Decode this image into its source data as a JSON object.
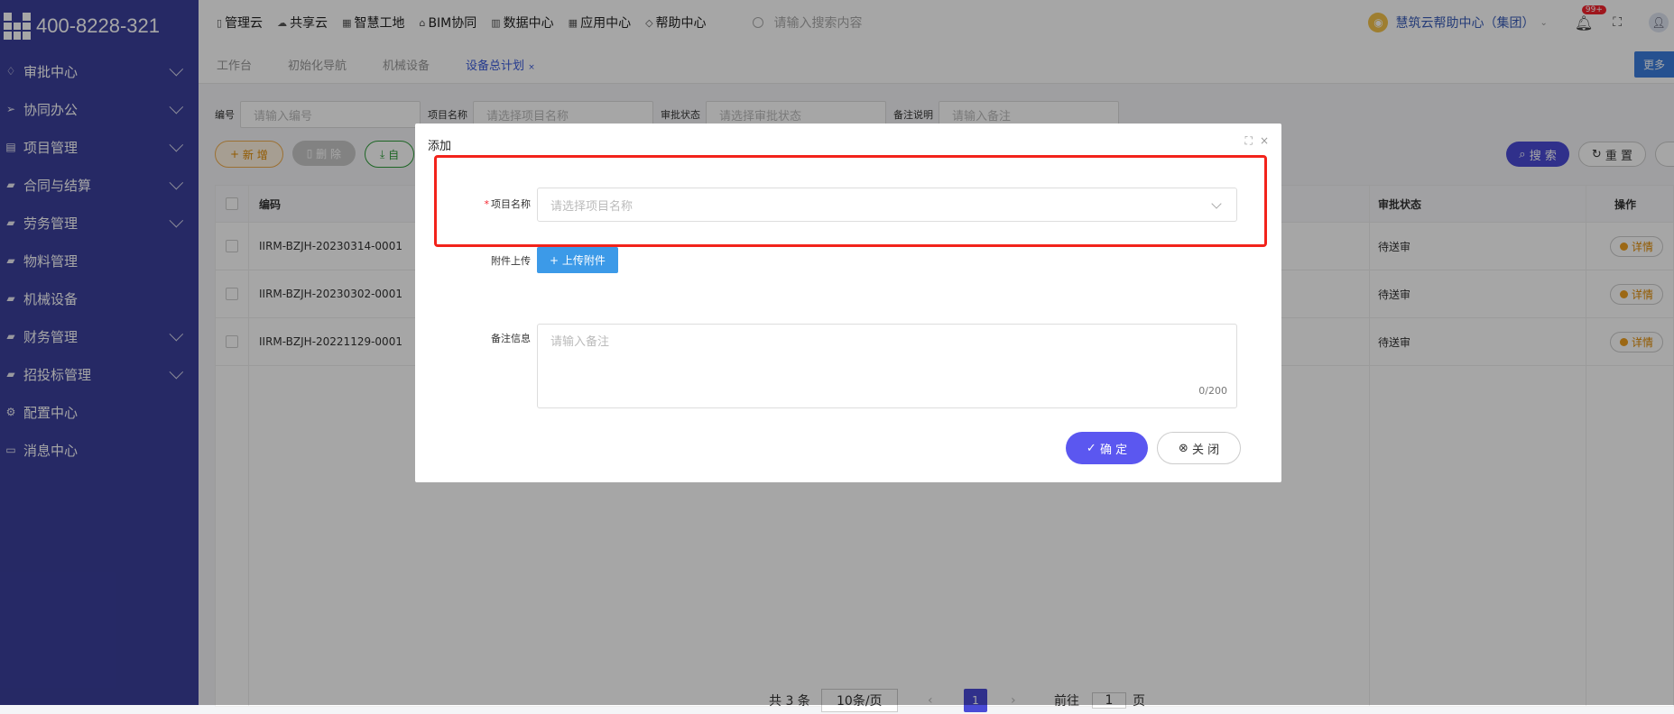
{
  "brand": {
    "phone": "400-8228-321"
  },
  "sidebar": {
    "items": [
      {
        "label": "审批中心",
        "icon": "bell-icon",
        "glyph": "♢",
        "expandable": true
      },
      {
        "label": "协同办公",
        "icon": "send-icon",
        "glyph": "➢",
        "expandable": true
      },
      {
        "label": "项目管理",
        "icon": "book-icon",
        "glyph": "▤",
        "expandable": true
      },
      {
        "label": "合同与结算",
        "icon": "contract-icon",
        "glyph": "▰",
        "expandable": true
      },
      {
        "label": "劳务管理",
        "icon": "worker-icon",
        "glyph": "▰",
        "expandable": true
      },
      {
        "label": "物料管理",
        "icon": "material-icon",
        "glyph": "▰",
        "expandable": false
      },
      {
        "label": "机械设备",
        "icon": "machine-icon",
        "glyph": "▰",
        "expandable": false
      },
      {
        "label": "财务管理",
        "icon": "finance-icon",
        "glyph": "▰",
        "expandable": true
      },
      {
        "label": "招投标管理",
        "icon": "bid-icon",
        "glyph": "▰",
        "expandable": true
      },
      {
        "label": "配置中心",
        "icon": "gear-icon",
        "glyph": "⚙",
        "expandable": false
      },
      {
        "label": "消息中心",
        "icon": "message-icon",
        "glyph": "▭",
        "expandable": false
      }
    ]
  },
  "topbar": {
    "nav": [
      "管理云",
      "共享云",
      "智慧工地",
      "BIM协同",
      "数据中心",
      "应用中心",
      "帮助中心"
    ],
    "search_placeholder": "请输入搜索内容",
    "company": "慧筑云帮助中心（集团）",
    "badge": "99+"
  },
  "tabs": [
    "工作台",
    "初始化导航",
    "机械设备",
    "设备总计划"
  ],
  "tab_more": "更多",
  "filters": {
    "code_label": "编号",
    "code_placeholder": "请输入编号",
    "project_label": "项目名称",
    "project_placeholder": "请选择项目名称",
    "status_label": "审批状态",
    "status_placeholder": "请选择审批状态",
    "remark_label": "备注说明",
    "remark_placeholder": "请输入备注"
  },
  "actions": {
    "add": "新 增",
    "delete": "删 除",
    "export": "自",
    "search": "搜 索",
    "reset": "重 置"
  },
  "table": {
    "headers": {
      "code": "编码",
      "status": "审批状态",
      "op": "操作"
    },
    "rows": [
      {
        "code": "IIRM-BZJH-20230314-0001",
        "status": "待送审",
        "detail": "详情"
      },
      {
        "code": "IIRM-BZJH-20230302-0001",
        "status": "待送审",
        "detail": "详情"
      },
      {
        "code": "IIRM-BZJH-20221129-0001",
        "status": "待送审",
        "detail": "详情"
      }
    ]
  },
  "pager": {
    "total": "共 3 条",
    "size": "10条/页",
    "current": "1",
    "goto": "前往",
    "goto_value": "1",
    "page": "页"
  },
  "modal": {
    "title": "添加",
    "project_label": "项目名称",
    "project_placeholder": "请选择项目名称",
    "upload_label": "附件上传",
    "upload_button": "上传附件",
    "remark_label": "备注信息",
    "remark_placeholder": "请输入备注",
    "counter": "0/200",
    "confirm": "确 定",
    "close": "关 闭"
  }
}
